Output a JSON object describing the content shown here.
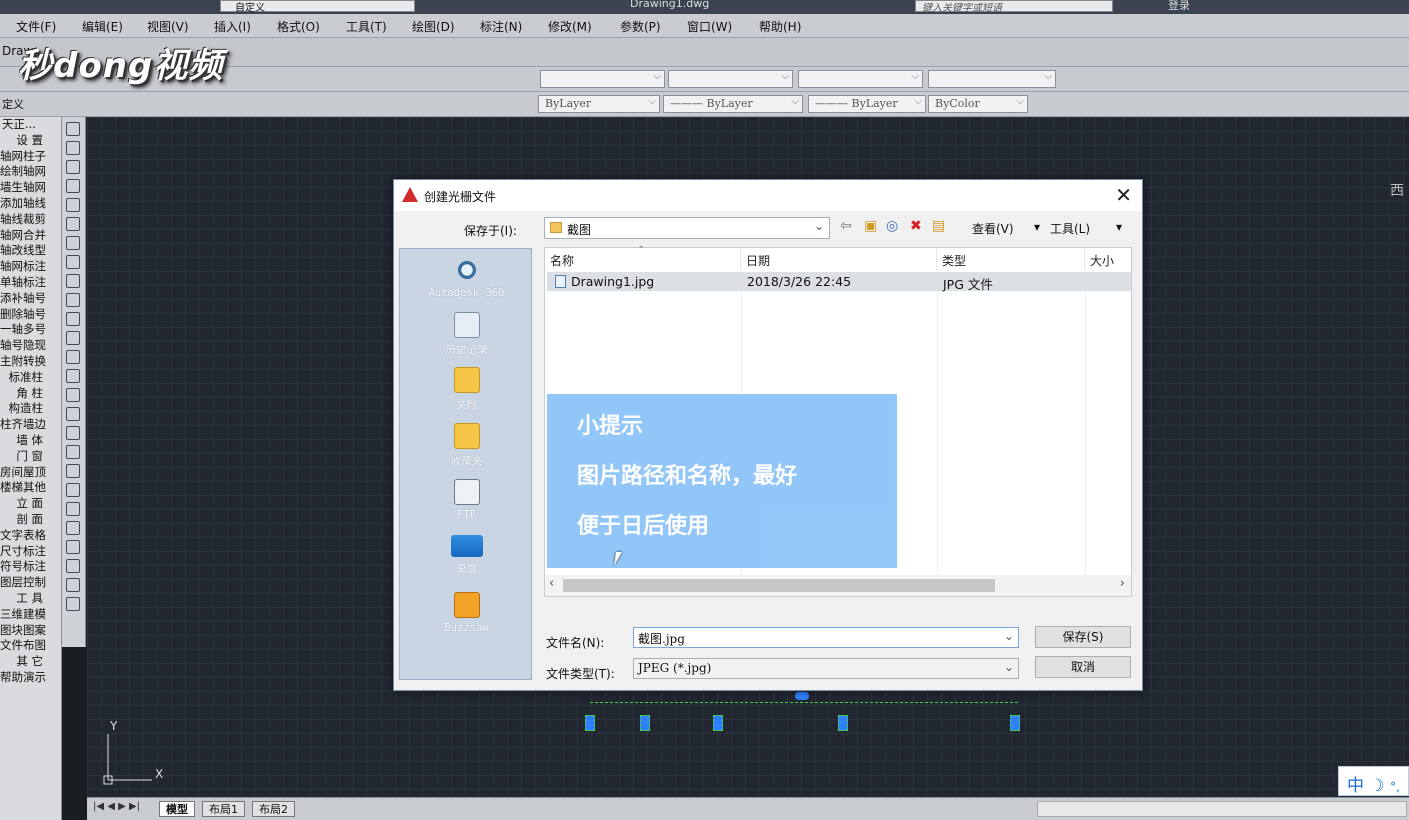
{
  "titlebar": {
    "workspace": "自定义",
    "doc_title": "Drawing1.dwg",
    "search_placeholder": "键入关键字或短语",
    "login": "登录"
  },
  "menus": [
    "文件(F)",
    "编辑(E)",
    "视图(V)",
    "插入(I)",
    "格式(O)",
    "工具(T)",
    "绘图(D)",
    "标注(N)",
    "修改(M)",
    "参数(P)",
    "窗口(W)",
    "帮助(H)"
  ],
  "logo_text": "秒dong视频",
  "properties": {
    "color": "ByLayer",
    "linetype": "ByLayer",
    "lineweight": "ByLayer",
    "plotstyle": "ByColor",
    "tab_draw": "Draw",
    "custom": "定义"
  },
  "left_panel": [
    "设 置",
    "轴网柱子",
    "绘制轴网",
    "墙生轴网",
    "添加轴线",
    "轴线裁剪",
    "轴网合并",
    "轴改线型",
    "轴网标注",
    "单轴标注",
    "添补轴号",
    "删除轴号",
    "一轴多号",
    "轴号隐现",
    "主附转换",
    "标准柱",
    "角 柱",
    "构造柱",
    "柱齐墙边",
    "墙 体",
    "门 窗",
    "房间屋顶",
    "楼梯其他",
    "立 面",
    "剖 面",
    "文字表格",
    "尺寸标注",
    "符号标注",
    "图层控制",
    "工 具",
    "三维建模",
    "图块图案",
    "文件布图",
    "其 它",
    "帮助演示"
  ],
  "left_panel_header": "天正...",
  "canvas": {
    "west_label": "西",
    "ucs_x": "X",
    "ucs_y": "Y"
  },
  "layout_tabs": [
    "模型",
    "布局1",
    "布局2"
  ],
  "ime": {
    "lang": "中",
    "moon": "☽",
    "punct": "°,"
  },
  "dialog": {
    "title": "创建光栅文件",
    "save_in_label": "保存于(I):",
    "save_in_value": "截图",
    "view_label": "查看(V)",
    "tools_label": "工具(L)",
    "places": [
      {
        "label": "Autodesk 360",
        "icon": "cloud-icon"
      },
      {
        "label": "历史记录",
        "icon": "history-icon"
      },
      {
        "label": "文档",
        "icon": "documents-icon"
      },
      {
        "label": "收藏夹",
        "icon": "favorites-icon"
      },
      {
        "label": "FTP",
        "icon": "ftp-icon"
      },
      {
        "label": "桌面",
        "icon": "desktop-icon"
      },
      {
        "label": "Buzzsaw",
        "icon": "buzzsaw-icon"
      }
    ],
    "columns": [
      "名称",
      "日期",
      "类型",
      "大小"
    ],
    "files": [
      {
        "name": "Drawing1.jpg",
        "date": "2018/3/26 22:45",
        "type": "JPG 文件",
        "size": ""
      }
    ],
    "tip": {
      "title": "小提示",
      "line1": "图片路径和名称，最好",
      "line2": "便于日后使用"
    },
    "filename_label": "文件名(N):",
    "filename_value": "截图.jpg",
    "filetype_label": "文件类型(T):",
    "filetype_value": "JPEG (*.jpg)",
    "save_button": "保存(S)",
    "cancel_button": "取消"
  }
}
